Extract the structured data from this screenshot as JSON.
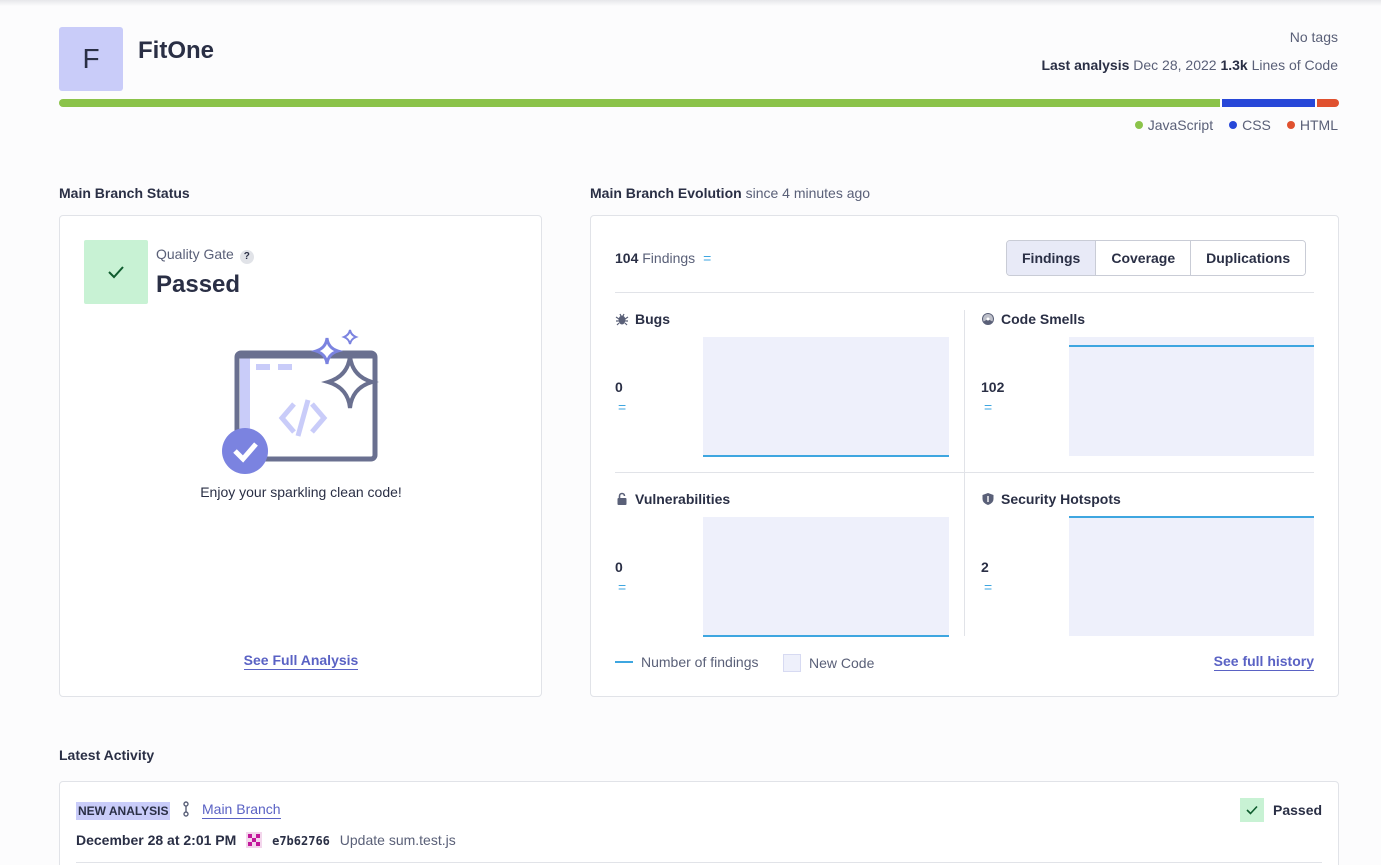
{
  "project": {
    "avatar_letter": "F",
    "name": "FitOne",
    "tags": "No tags",
    "last_analysis_label": "Last analysis",
    "last_analysis_date": "Dec 28, 2022",
    "lines_count": "1.3k",
    "lines_label": "Lines of Code"
  },
  "languages": [
    {
      "name": "JavaScript",
      "share": 0.91,
      "color": "#8bc34a"
    },
    {
      "name": "CSS",
      "share": 0.073,
      "color": "#2747d8"
    },
    {
      "name": "HTML",
      "share": 0.017,
      "color": "#e0512f"
    }
  ],
  "branch_status": {
    "heading": "Main Branch Status",
    "quality_gate_label": "Quality Gate",
    "help": "?",
    "status": "Passed",
    "message": "Enjoy your sparkling clean code!",
    "link": "See Full Analysis"
  },
  "evolution": {
    "heading": "Main Branch Evolution",
    "since": "since 4 minutes ago",
    "findings_count": "104",
    "findings_label": "Findings",
    "findings_trend": "=",
    "tabs": [
      "Findings",
      "Coverage",
      "Duplications"
    ],
    "metrics": [
      {
        "name": "Bugs",
        "icon": "bug-icon",
        "value": "0",
        "trend": "=",
        "level": 0.0
      },
      {
        "name": "Code Smells",
        "icon": "code-smell-icon",
        "value": "102",
        "trend": "=",
        "level": 0.93
      },
      {
        "name": "Vulnerabilities",
        "icon": "lock-icon",
        "value": "0",
        "trend": "=",
        "level": 0.0
      },
      {
        "name": "Security Hotspots",
        "icon": "shield-icon",
        "value": "2",
        "trend": "=",
        "level": 1.0
      }
    ],
    "legend_findings": "Number of findings",
    "legend_new_code": "New Code",
    "history_link": "See full history"
  },
  "activity": {
    "heading": "Latest Activity",
    "badge": "NEW ANALYSIS",
    "branch": "Main Branch",
    "date": "December 28 at 2:01 PM",
    "commit_hash": "e7b62766",
    "commit_message": "Update sum.test.js",
    "status": "Passed"
  },
  "colors": {
    "accent": "#5a62c4",
    "passed_bg": "#c8f2d4",
    "trend_line": "#3ea6e0",
    "new_code_bg": "#eef0fb"
  }
}
